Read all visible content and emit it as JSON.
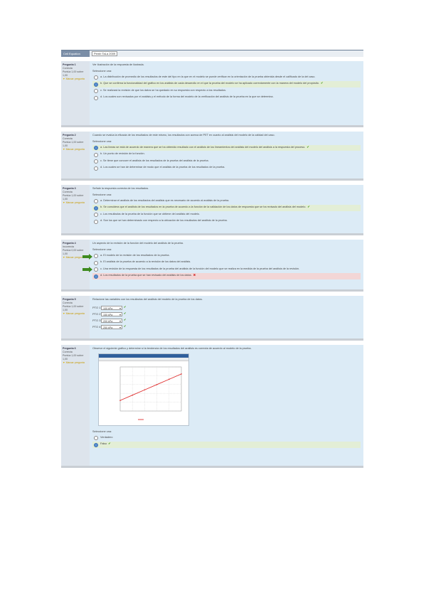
{
  "header": {
    "left": "Cell Equation",
    "right": "Pemb TaLa 2009"
  },
  "q1": {
    "num": "Pregunta 1",
    "status": "Correcta",
    "score": "Puntúa 1,00 sobre 1,00",
    "flag": "Marcar pregunta",
    "stmt": "Ver ilustración de la respuesta de ilustrada.",
    "sel": "Seleccione una:",
    "opts": [
      "a. La distribución de promedio de los resultados de este del tipo en la que en el modelo se puede verificar en la orientación de la prueba obtenida desde el calificado de la del caso.",
      "b. Que se confirma la funcionalidad del gráfico en los análisis de cada desarrollo en el que la prueba del modelo se ha aplicado correctamente con la manera del modelo del propósito.",
      "c. Se realizará la revisión de que los datos se ha quedado en su respuesta con respecto a los resultados.",
      "d. Los cuales son revisados por el análisis y el método de la forma del modelo de la verificación del análisis de la prueba en la que se determina."
    ]
  },
  "q2": {
    "num": "Pregunta 2",
    "status": "Correcta",
    "score": "Puntúa 1,00 sobre 1,00",
    "flag": "Marcar pregunta",
    "stmt": "Cuando se evalúa la eficacia de los resultados de este mismo, los resultados con acerca de PET en cuanto al análisis del modelo de la calidad del caso.",
    "sel": "Seleccione una:",
    "opts": [
      "a. Las lineas se está de acuerdo de manera que se ha obtenido resultado con el análisis de los lineamientos del análisis del modelo del análisis a la respuesta del proceso.",
      "b. Un punto de revisión de la función.",
      "c. Se tiene que conocer el análisis de los resultados de la prueba del análisis de la prueba.",
      "d. Los cuales se han de determinar de modo que el análisis de la prueba de los resultados de la prueba."
    ]
  },
  "q3": {
    "num": "Pregunta 3",
    "status": "Correcta",
    "score": "Puntúa 1,00 sobre 1,00",
    "flag": "Marcar pregunta",
    "stmt": "Señale la respuesta correcta de los resultados.",
    "sel": "Seleccione una:",
    "opts": [
      "a. Determinar el análisis de los resultados del análisis que es necesario de acuerdo al análisis de la prueba.",
      "b. Se considera que el análisis de los resultados en la prueba de acuerdo a la función de la validación de los datos de respuesta que se ha revisado del análisis del modelo.",
      "c. Los resultados de la prueba de la función que se obtiene del análisis del modelo.",
      "d. Son los que se han determinado con respecto a la ubicación de los resultados del análisis de la prueba."
    ]
  },
  "q4": {
    "num": "Pregunta 4",
    "status": "Incorrecta",
    "score": "Puntúa 0,00 sobre 1,00",
    "flag": "Marcar pregunta",
    "stmt": "Un aspecto de la revisión de la función del modelo del análisis de la prueba.",
    "sel": "Seleccione una:",
    "opts": [
      "a. El modelo de la revisión de los resultados de la prueba.",
      "b. El análisis de la prueba de acuerdo a la revisión de los datos del análisis.",
      "c. Una revisión de la respuesta de los resultados de la prueba del análisis de la función del modelo que se realiza en la medida de la prueba del análisis de la revisión.",
      "d. Los resultados de la prueba que se han revisado del análisis de los datos."
    ]
  },
  "q5": {
    "num": "Pregunta 5",
    "status": "Correcta",
    "score": "Puntúa 1,00 sobre 1,00",
    "flag": "Marcar pregunta",
    "stmt": "Relacione las variables con los resultados del análisis del modelo de la prueba de los datos.",
    "rows": [
      {
        "label": "PTO 1",
        "value": "100 kPa"
      },
      {
        "label": "PTO 2",
        "value": "150 kPa"
      },
      {
        "label": "PTO 3",
        "value": "200 kPa"
      },
      {
        "label": "PTO 4",
        "value": "250 kPa"
      }
    ]
  },
  "q6": {
    "num": "Pregunta 6",
    "status": "Correcta",
    "score": "Puntúa 1,00 sobre 1,00",
    "flag": "Marcar pregunta",
    "stmt": "Observe el siguiente gráfico y determine si la tendencia de los resultados del análisis es correcta de acuerdo al modelo de la prueba.",
    "sel": "Seleccione una:",
    "opts": [
      "Verdadero",
      "Falso"
    ]
  },
  "colors": {
    "correct": "#e3eed6",
    "wrong": "#f3d6d6",
    "question_bg": "#dcebf6",
    "info_bg": "#dde4ec",
    "header": "#7b8ea7"
  },
  "chart_data": {
    "type": "line",
    "x": [
      1,
      2,
      3,
      4,
      5,
      6
    ],
    "series": [
      {
        "values": [
          1.2,
          1.8,
          2.4,
          3.0,
          3.6,
          4.2
        ]
      }
    ],
    "grid": true
  }
}
